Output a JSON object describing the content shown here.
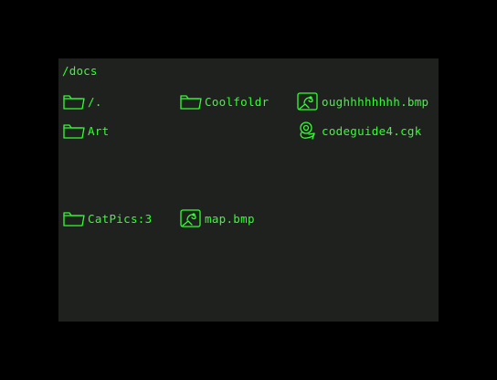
{
  "theme": {
    "background": "#000000",
    "panel": "#1e211e",
    "accent": "#33ff33"
  },
  "window": {
    "path": "/docs"
  },
  "items": [
    {
      "name": "/.",
      "icon": "folder-icon"
    },
    {
      "name": "Coolfoldr",
      "icon": "folder-icon"
    },
    {
      "name": "oughhhhhhhh.bmp",
      "icon": "image-file-icon"
    },
    {
      "name": "Art",
      "icon": "folder-icon"
    },
    {
      "name": "codeguide4.cgk",
      "icon": "code-guide-icon"
    },
    {
      "name": "CatPics:3",
      "icon": "folder-icon"
    },
    {
      "name": "map.bmp",
      "icon": "image-file-icon"
    }
  ]
}
